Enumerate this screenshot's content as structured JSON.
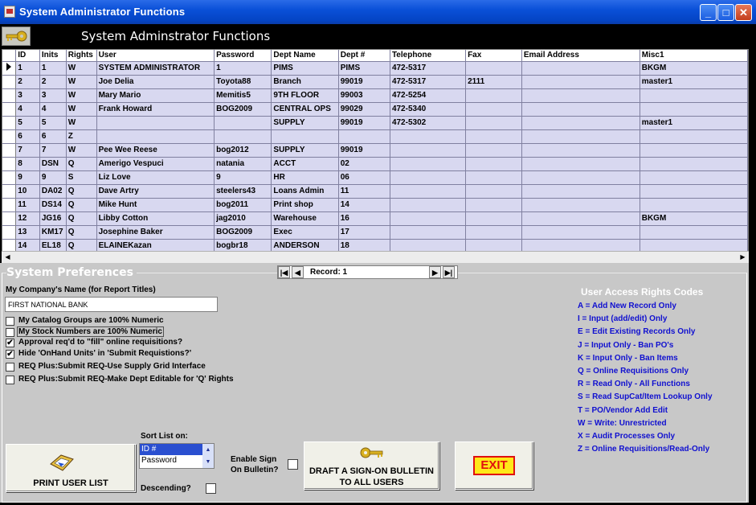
{
  "window": {
    "title": "System Administrator Functions"
  },
  "header": {
    "title": "System Adminstrator Functions"
  },
  "grid": {
    "columns": [
      "ID",
      "Inits",
      "Rights",
      "User",
      "Password",
      "Dept Name",
      "Dept #",
      "Telephone",
      "Fax",
      "Email Address",
      "Misc1"
    ],
    "rows": [
      [
        "1",
        "1",
        "W",
        "SYSTEM ADMINISTRATOR",
        "1",
        "PIMS",
        "PIMS",
        "472-5317",
        "",
        "",
        "BKGM"
      ],
      [
        "2",
        "2",
        "W",
        "Joe Delia",
        "Toyota88",
        "Branch",
        "99019",
        "472-5317",
        "2111",
        "",
        "master1"
      ],
      [
        "3",
        "3",
        "W",
        "Mary Mario",
        "Memitis5",
        "9TH FLOOR",
        "99003",
        "472-5254",
        "",
        "",
        ""
      ],
      [
        "4",
        "4",
        "W",
        "Frank Howard",
        "BOG2009",
        "CENTRAL OPS",
        "99029",
        "472-5340",
        "",
        "",
        ""
      ],
      [
        "5",
        "5",
        "W",
        "",
        "",
        "SUPPLY",
        "99019",
        "472-5302",
        "",
        "",
        "master1"
      ],
      [
        "6",
        "6",
        "Z",
        "",
        "",
        "",
        "",
        "",
        "",
        "",
        ""
      ],
      [
        "7",
        "7",
        "W",
        "Pee Wee Reese",
        "bog2012",
        "SUPPLY",
        "99019",
        "",
        "",
        "",
        ""
      ],
      [
        "8",
        "DSN",
        "Q",
        "Amerigo Vespuci",
        "natania",
        "ACCT",
        "02",
        "",
        "",
        "",
        ""
      ],
      [
        "9",
        "9",
        "S",
        "Liz Love",
        "9",
        "HR",
        "06",
        "",
        "",
        "",
        ""
      ],
      [
        "10",
        "DA02",
        "Q",
        "Dave Artry",
        "steelers43",
        "Loans Admin",
        "11",
        "",
        "",
        "",
        ""
      ],
      [
        "11",
        "DS14",
        "Q",
        "Mike Hunt",
        "bog2011",
        "Print shop",
        "14",
        "",
        "",
        "",
        ""
      ],
      [
        "12",
        "JG16",
        "Q",
        "Libby Cotton",
        "jag2010",
        "Warehouse",
        "16",
        "",
        "",
        "",
        "BKGM"
      ],
      [
        "13",
        "KM17",
        "Q",
        "Josephine Baker",
        "BOG2009",
        "Exec",
        "17",
        "",
        "",
        "",
        ""
      ],
      [
        "14",
        "EL18",
        "Q",
        "ELAINEKazan",
        "bogbr18",
        "ANDERSON",
        "18",
        "",
        "",
        "",
        ""
      ]
    ]
  },
  "nav": {
    "record": "Record: 1"
  },
  "prefs": {
    "title": "System Preferences",
    "company_label": "My Company's Name (for Report Titles)",
    "company_value": "FIRST NATIONAL BANK",
    "options": [
      {
        "label": "My Catalog Groups are 100% Numeric",
        "checked": false
      },
      {
        "label": "My Stock Numbers are 100% Numeric",
        "checked": false
      },
      {
        "label": "Approval req'd to \"fill\" online requisitions?",
        "checked": true
      },
      {
        "label": "Hide 'OnHand Units' in 'Submit Requistions?'",
        "checked": true
      },
      {
        "label": "REQ Plus:Submit REQ-Use Supply Grid Interface",
        "checked": false
      },
      {
        "label": "REQ Plus:Submit REQ-Make Dept Editable for 'Q' Rights",
        "checked": false
      }
    ]
  },
  "codes": {
    "title": "User Access Rights Codes",
    "items": [
      "A = Add New Record Only",
      "I = Input (add/edit) Only",
      "E = Edit Existing Records Only",
      "J = Input Only - Ban PO's",
      "K = Input Only - Ban Items",
      "Q = Online Requisitions Only",
      "R = Read Only - All Functions",
      "S = Read SupCat/Item Lookup Only",
      "T = PO/Vendor Add  Edit",
      "W = Write: Unrestricted",
      "X = Audit Processes Only",
      "Z = Online Requisitions/Read-Only"
    ]
  },
  "actions": {
    "print_label": "PRINT USER LIST",
    "sort_label": "Sort List on:",
    "sort_options": [
      "ID #",
      "Password"
    ],
    "descending_label": "Descending?",
    "enable_sign_label_1": "Enable Sign",
    "enable_sign_label_2": "On Bulletin?",
    "draft_label_1": "DRAFT A SIGN-ON BULLETIN",
    "draft_label_2": "TO ALL USERS",
    "exit_label": "EXIT"
  },
  "icons": {
    "app": "app-icon",
    "key": "key-icon",
    "printer": "printer-icon"
  },
  "colors": {
    "titlebar": "#0a50d8",
    "row": "#d8d8f0",
    "codes": "#1010d0",
    "panel": "#c8c8c8",
    "exit": "#e01010"
  }
}
